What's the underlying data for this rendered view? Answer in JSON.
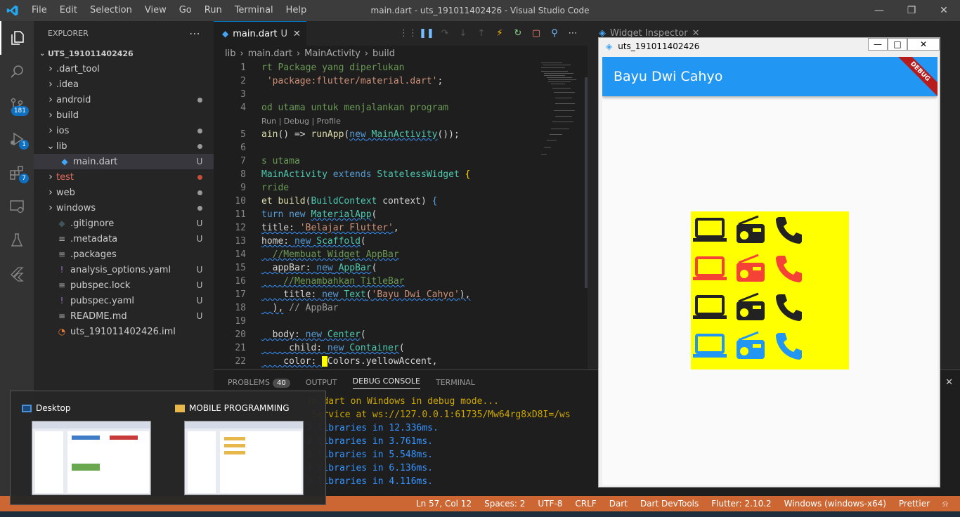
{
  "titlebar": {
    "logo": "vscode-logo",
    "menu": [
      "File",
      "Edit",
      "Selection",
      "View",
      "Go",
      "Run",
      "Terminal",
      "Help"
    ],
    "title": "main.dart - uts_191011402426 - Visual Studio Code"
  },
  "activity": {
    "badges": {
      "scm": "181",
      "debug": "1",
      "extensions": "7"
    }
  },
  "explorer": {
    "header": "EXPLORER",
    "root": "UTS_191011402426",
    "items": [
      {
        "name": ".dart_tool",
        "folder": true,
        "open": false,
        "status": "",
        "color": "#cccccc"
      },
      {
        "name": ".idea",
        "folder": true,
        "open": false,
        "status": "",
        "color": "#cccccc"
      },
      {
        "name": "android",
        "folder": true,
        "open": false,
        "status": "dot",
        "color": "#cccccc"
      },
      {
        "name": "build",
        "folder": true,
        "open": false,
        "status": "",
        "color": "#cccccc"
      },
      {
        "name": "ios",
        "folder": true,
        "open": false,
        "status": "dot",
        "color": "#cccccc"
      },
      {
        "name": "lib",
        "folder": true,
        "open": true,
        "status": "dot",
        "color": "#cccccc"
      },
      {
        "name": "main.dart",
        "folder": false,
        "indent": true,
        "status": "U",
        "color": "#cccccc",
        "selected": true
      },
      {
        "name": "test",
        "folder": true,
        "open": false,
        "status": "reddot",
        "color": "#e06c5a"
      },
      {
        "name": "web",
        "folder": true,
        "open": false,
        "status": "dot",
        "color": "#cccccc"
      },
      {
        "name": "windows",
        "folder": true,
        "open": false,
        "status": "dot",
        "color": "#cccccc"
      },
      {
        "name": ".gitignore",
        "folder": false,
        "status": "U",
        "color": "#cccccc"
      },
      {
        "name": ".metadata",
        "folder": false,
        "status": "U",
        "color": "#cccccc"
      },
      {
        "name": ".packages",
        "folder": false,
        "status": "",
        "color": "#cccccc"
      },
      {
        "name": "analysis_options.yaml",
        "folder": false,
        "status": "U",
        "color": "#cccccc"
      },
      {
        "name": "pubspec.lock",
        "folder": false,
        "status": "U",
        "color": "#cccccc"
      },
      {
        "name": "pubspec.yaml",
        "folder": false,
        "status": "U",
        "color": "#cccccc"
      },
      {
        "name": "README.md",
        "folder": false,
        "status": "U",
        "color": "#cccccc"
      },
      {
        "name": "uts_191011402426.iml",
        "folder": false,
        "status": "",
        "color": "#cccccc"
      }
    ]
  },
  "editor": {
    "tab_label": "main.dart",
    "tab_status": "U",
    "breadcrumb": [
      "lib",
      "main.dart",
      "MainActivity",
      "build"
    ],
    "codelens": "Run | Debug | Profile",
    "lines": [
      {
        "n": "1",
        "html": "<span class='cm'>rt Package yang diperlukan</span>"
      },
      {
        "n": "2",
        "html": "<span class='str'> 'package:flutter/material.dart'</span><span class='pl'>;</span>"
      },
      {
        "n": "3",
        "html": ""
      },
      {
        "n": "4",
        "html": "<span class='cm'>od utama untuk menjalankan program</span>"
      },
      {
        "n": "lens",
        "html": ""
      },
      {
        "n": "5",
        "html": "<span class='fn'>ain</span><span class='pl'>() =&gt; </span><span class='fn'>runApp</span><span class='pl'>(</span><span class='kw squig'>new</span><span class='ty squig'> MainActivity</span><span class='pl'>());</span>"
      },
      {
        "n": "6",
        "html": ""
      },
      {
        "n": "7",
        "html": "<span class='cm'>s utama</span>"
      },
      {
        "n": "8",
        "html": "<span class='ty'>MainActivity</span><span class='kw'> extends </span><span class='ty'>StatelessWidget</span><span class='yel'> {</span>"
      },
      {
        "n": "9",
        "html": "<span class='cm'>rride</span>"
      },
      {
        "n": "10",
        "html": "<span class='fn'>et build</span><span class='pl'>(</span><span class='ty'>BuildContext</span><span class='pl'> context) </span><span class='kw'>{</span>"
      },
      {
        "n": "11",
        "html": "<span class='kw'>turn new </span><span class='ty squig'>MaterialApp</span><span class='pl'>(</span>"
      },
      {
        "n": "12",
        "html": "<span class='pl squig'>title: </span><span class='str squig'>'Belajar Flutter'</span><span class='pl'>,</span>"
      },
      {
        "n": "13",
        "html": "<span class='pl squig'>home: </span><span class='kw squig'>new</span><span class='ty squig'> Scaffold</span><span class='pl'>(</span>"
      },
      {
        "n": "14",
        "html": "<span class='cm squig'>  //Membuat Widget AppBar</span>"
      },
      {
        "n": "15",
        "html": "<span class='pl squig'>  appBar: </span><span class='kw squig'>new</span><span class='ty squig'> AppBar</span><span class='pl'>(</span>"
      },
      {
        "n": "16",
        "html": "<span class='cm squig'>    //Menambahkan TitleBar</span>"
      },
      {
        "n": "17",
        "html": "<span class='pl squig'>    title: </span><span class='kw squig'>new</span><span class='ty squig'> Text</span><span class='pl squig'>(</span><span class='str squig'>'Bayu Dwi Cahyo'</span><span class='pl squig'>),</span>"
      },
      {
        "n": "18",
        "html": "<span class='pl squig'>  ),</span><span class='gry'> // AppBar</span>"
      },
      {
        "n": "19",
        "html": ""
      },
      {
        "n": "20",
        "html": "<span class='pl squig'>  body: </span><span class='kw squig'>new</span><span class='ty squig'> Center</span><span class='pl'>(</span>"
      },
      {
        "n": "21",
        "html": "<span class='pl squig'>     child: </span><span class='kw squig'>new</span><span class='ty squig'> Container</span><span class='pl'>(</span>"
      },
      {
        "n": "22",
        "html": "<span class='pl squig'>    color: </span><span style='background:#ffff00'> </span><span class='pl'>Colors.yellowAccent,</span>"
      }
    ]
  },
  "panel": {
    "tabs": [
      "PROBLEMS",
      "OUTPUT",
      "DEBUG CONSOLE",
      "TERMINAL"
    ],
    "problem_count": "40",
    "console": [
      {
        "text": "in.dart on Windows in debug mode...",
        "color": "#cca700"
      },
      {
        "text": " Service at ws://127.0.0.1:61735/Mw64rg8xD8I=/ws",
        "color": "#cca700"
      },
      {
        "text": "3 libraries in 12.336ms.",
        "color": "#3794ff"
      },
      {
        "text": "3 libraries in 3.761ms.",
        "color": "#3794ff"
      },
      {
        "text": "3 libraries in 5.548ms.",
        "color": "#3794ff"
      },
      {
        "text": "3 libraries in 6.136ms.",
        "color": "#3794ff"
      },
      {
        "text": "3 libraries in 4.116ms.",
        "color": "#3794ff"
      }
    ]
  },
  "widget_inspector_tab": "Widget Inspector",
  "thumbnails": [
    {
      "title": "Desktop",
      "icon": "desktop-icon"
    },
    {
      "title": "MOBILE PROGRAMMING",
      "icon": "folder-icon"
    }
  ],
  "statusbar": {
    "items": [
      "Ln 57, Col 12",
      "Spaces: 2",
      "UTF-8",
      "CRLF",
      "Dart",
      "Dart DevTools",
      "Flutter: 2.10.2",
      "Windows (windows-x64)",
      "Prettier"
    ]
  },
  "flutter_window": {
    "title": "uts_191011402426",
    "appbar_title": "Bayu Dwi Cahyo",
    "debug_banner": "DEBUG",
    "box_color": "#ffff00",
    "icon_rows": [
      {
        "color": "#222222",
        "icons": [
          "laptop-icon",
          "radio-icon",
          "phone-icon"
        ]
      },
      {
        "color": "#f44336",
        "icons": [
          "laptop-icon",
          "radio-icon",
          "phone-icon"
        ]
      },
      {
        "color": "#222222",
        "icons": [
          "laptop-icon",
          "radio-icon",
          "phone-icon"
        ]
      },
      {
        "color": "#2196f3",
        "icons": [
          "laptop-icon",
          "radio-icon",
          "phone-icon"
        ]
      }
    ]
  }
}
